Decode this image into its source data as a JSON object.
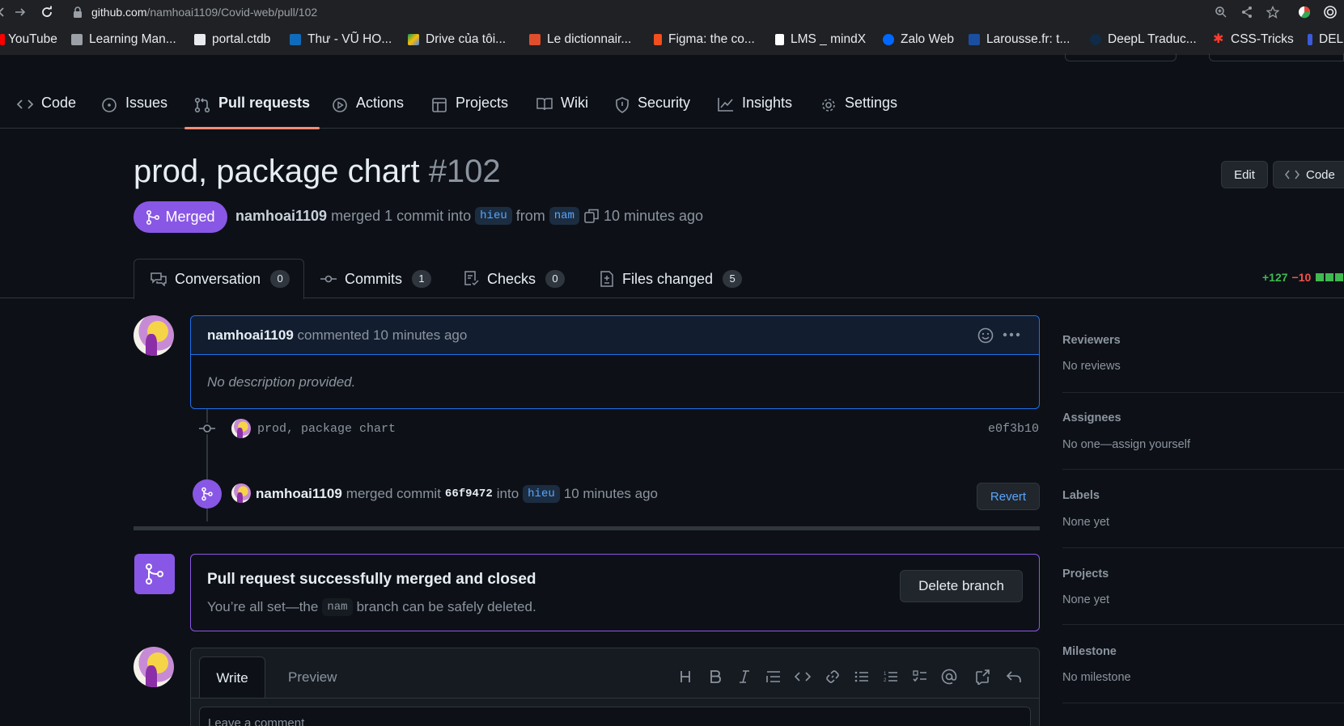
{
  "browser": {
    "url_host": "github.com",
    "url_path": "/namhoai1109/Covid-web/pull/102",
    "bookmarks": [
      {
        "label": "YouTube",
        "color": "#ff0000"
      },
      {
        "label": "Learning Man...",
        "color": "#9aa0a6"
      },
      {
        "label": "portal.ctdb",
        "color": "#e8eaed"
      },
      {
        "label": "Thư - VŨ HO...",
        "color": "#0f6cbd"
      },
      {
        "label": "Drive của tôi...",
        "color": "#fbbc04"
      },
      {
        "label": "Le dictionnair...",
        "color": "#e04e2c"
      },
      {
        "label": "Figma: the co...",
        "color": "#f24e1e"
      },
      {
        "label": "LMS _ mindX",
        "color": "#ffffff"
      },
      {
        "label": "Zalo Web",
        "color": "#0068ff"
      },
      {
        "label": "Larousse.fr: t...",
        "color": "#1a4ea0"
      },
      {
        "label": "DeepL Traduc...",
        "color": "#0f2b46"
      },
      {
        "label": "CSS-Tricks",
        "color": "#ff3b30"
      },
      {
        "label": "DEL",
        "color": "#3b5bdb"
      }
    ]
  },
  "repo_nav": {
    "tabs": [
      {
        "label": "Code",
        "icon": "code-icon"
      },
      {
        "label": "Issues",
        "icon": "issue-icon"
      },
      {
        "label": "Pull requests",
        "icon": "pull-request-icon"
      },
      {
        "label": "Actions",
        "icon": "play-icon"
      },
      {
        "label": "Projects",
        "icon": "table-icon"
      },
      {
        "label": "Wiki",
        "icon": "book-icon"
      },
      {
        "label": "Security",
        "icon": "shield-icon"
      },
      {
        "label": "Insights",
        "icon": "graph-icon"
      },
      {
        "label": "Settings",
        "icon": "gear-icon"
      }
    ],
    "active": "Pull requests"
  },
  "pr": {
    "title": "prod, package chart",
    "number": "#102",
    "edit_label": "Edit",
    "code_label": "Code",
    "state": "Merged",
    "author": "namhoai1109",
    "merge_text": "merged 1 commit into",
    "base_branch": "hieu",
    "from_text": "from",
    "head_branch": "nam",
    "time": "10 minutes ago"
  },
  "pr_tabs": [
    {
      "label": "Conversation",
      "count": "0"
    },
    {
      "label": "Commits",
      "count": "1"
    },
    {
      "label": "Checks",
      "count": "0"
    },
    {
      "label": "Files changed",
      "count": "5"
    }
  ],
  "diffstat": {
    "additions": "+127",
    "deletions": "−10"
  },
  "comment": {
    "author": "namhoai1109",
    "action": "commented 10 minutes ago",
    "body": "No description provided."
  },
  "commit": {
    "message": "prod, package chart",
    "sha": "e0f3b10"
  },
  "merge_event": {
    "author": "namhoai1109",
    "text": "merged commit",
    "sha": "66f9472",
    "into": "into",
    "branch": "hieu",
    "time": "10 minutes ago",
    "revert_label": "Revert"
  },
  "merged_box": {
    "title": "Pull request successfully merged and closed",
    "desc_before": "You’re all set—the",
    "branch": "nam",
    "desc_after": "branch can be safely deleted.",
    "delete_label": "Delete branch"
  },
  "editor": {
    "write_label": "Write",
    "preview_label": "Preview",
    "placeholder": "Leave a comment"
  },
  "sidebar": {
    "sections": [
      {
        "title": "Reviewers",
        "value": "No reviews"
      },
      {
        "title": "Assignees",
        "value": "No one—assign yourself"
      },
      {
        "title": "Labels",
        "value": "None yet"
      },
      {
        "title": "Projects",
        "value": "None yet"
      },
      {
        "title": "Milestone",
        "value": "No milestone"
      }
    ]
  },
  "colors": {
    "merged": "#8957e5",
    "tab_underline": "#fd8c73",
    "additions": "#3fb950",
    "deletions": "#f85149"
  }
}
